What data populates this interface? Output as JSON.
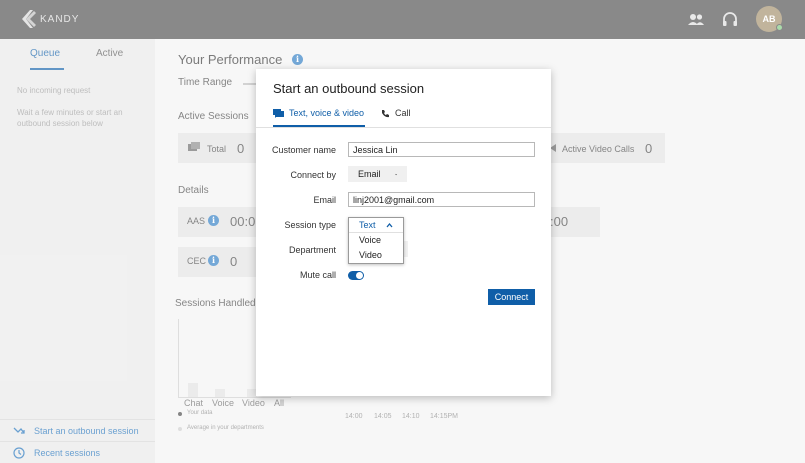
{
  "header": {
    "logo_text": "KANDY",
    "avatar_initials": "AB"
  },
  "sidebar": {
    "tabs": [
      {
        "label": "Queue"
      },
      {
        "label": "Active"
      }
    ],
    "empty_title": "No incoming request",
    "empty_text": "Wait a few minutes or start an outbound session below",
    "links": [
      {
        "label": "Start an outbound session"
      },
      {
        "label": "Recent sessions"
      }
    ]
  },
  "main": {
    "title": "Your Performance",
    "time_range_label": "Time Range",
    "active_sessions_label": "Active Sessions",
    "total_label": "Total",
    "total_value": "0",
    "active_video_label": "Active Video Calls",
    "active_video_value": "0",
    "details_label": "Details",
    "aas_label": "AAS",
    "aas_value": "00:0",
    "aas_right_value": ":00",
    "cec_label": "CEC",
    "cec_value": "0",
    "sessions_handled_label": "Sessions Handled",
    "bar_categories": [
      "Chat",
      "Voice",
      "Video",
      "All"
    ],
    "legend": [
      "Your data",
      "Average in your departments"
    ],
    "time_ticks": [
      "14:00",
      "14:05",
      "14:10",
      "14:15PM"
    ]
  },
  "modal": {
    "title": "Start an outbound session",
    "tabs": [
      {
        "label": "Text, voice & video"
      },
      {
        "label": "Call"
      }
    ],
    "customer_name_label": "Customer name",
    "customer_name_value": "Jessica Lin",
    "connect_by_label": "Connect by",
    "connect_by_value": "Email",
    "email_label": "Email",
    "email_value": "linj2001@gmail.com",
    "session_type_label": "Session type",
    "session_type_selected": "Text",
    "session_type_options": [
      "Voice",
      "Video"
    ],
    "department_label": "Department",
    "mute_call_label": "Mute call",
    "mute_call_on": true,
    "connect_label": "Connect"
  },
  "colors": {
    "accent": "#0f5ea8",
    "topbar": "#4a4a4a",
    "avatar": "#a08c68"
  }
}
